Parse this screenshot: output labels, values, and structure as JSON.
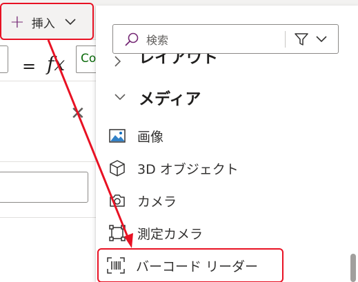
{
  "toolbar": {
    "insert_label": "挿入"
  },
  "formula_bar": {
    "equals": "=",
    "fx": "fx",
    "formula_text": "Co"
  },
  "flyout": {
    "search": {
      "placeholder": "検索"
    },
    "groups": [
      {
        "label": "レイアウト",
        "expanded": false,
        "items": []
      },
      {
        "label": "メディア",
        "expanded": true,
        "items": [
          {
            "label": "画像",
            "icon": "image-icon"
          },
          {
            "label": "3D オブジェクト",
            "icon": "cube-icon"
          },
          {
            "label": "カメラ",
            "icon": "camera-icon"
          },
          {
            "label": "測定カメラ",
            "icon": "measure-camera-icon"
          },
          {
            "label": "バーコード リーダー",
            "icon": "barcode-icon",
            "highlighted": true
          }
        ]
      }
    ]
  },
  "colors": {
    "accent": "#742774",
    "callout": "#e81123"
  }
}
